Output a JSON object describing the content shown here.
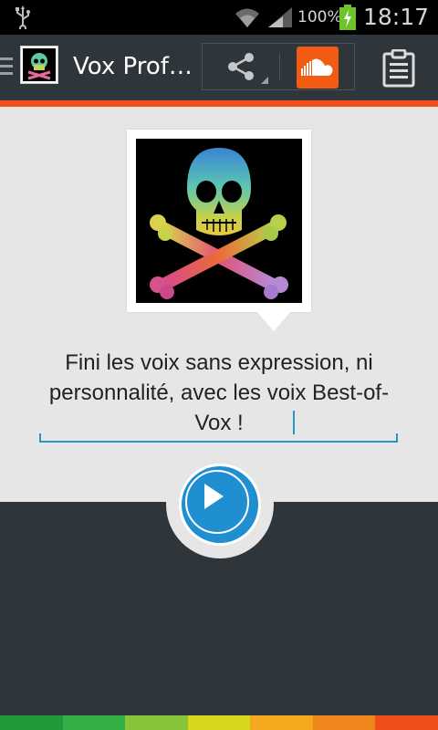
{
  "status_bar": {
    "battery_percent": "100%",
    "time": "18:17"
  },
  "action_bar": {
    "title": "Vox Prof…",
    "icons": [
      "menu-icon",
      "app-skull-icon",
      "share-icon",
      "soundcloud-icon",
      "clipboard-icon"
    ],
    "soundcloud_color": "#f35a12"
  },
  "accent_color": "#f04e1c",
  "main": {
    "tagline": "Fini les voix sans expression, ni personnalité, avec les voix Best-of-Vox !",
    "play_icon": "play-icon",
    "play_color": "#1f8fd2"
  },
  "footer_strip_colors": [
    "#1f9a3a",
    "#35b047",
    "#88c43a",
    "#d7d81c",
    "#f4a81d",
    "#f0871d",
    "#ee4e1a"
  ]
}
